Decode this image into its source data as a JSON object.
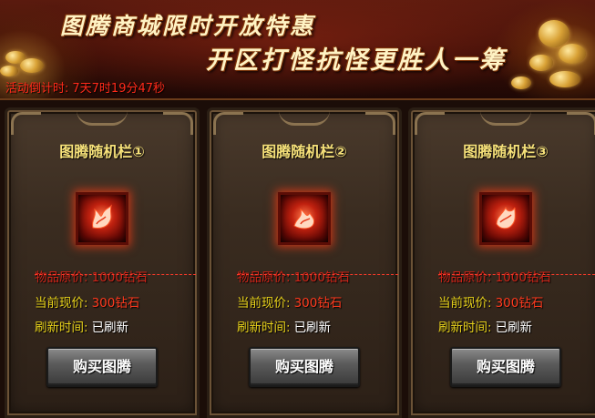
{
  "banner": {
    "title_line1": "图腾商城限时开放特惠",
    "title_line2": "开区打怪抗怪更胜人一筹"
  },
  "countdown": {
    "label": "活动倒计时:",
    "value": "7天7时19分47秒"
  },
  "cards": [
    {
      "title": "图腾随机栏①",
      "item_icon": "phoenix-totem-icon",
      "original_price_label": "物品原价:",
      "original_price": "1000钻石",
      "current_price_label": "当前现价:",
      "current_price": "300钻石",
      "refresh_label": "刷新时间:",
      "refresh_value": "已刷新",
      "buy_label": "购买图腾"
    },
    {
      "title": "图腾随机栏②",
      "item_icon": "phoenix-totem-icon",
      "original_price_label": "物品原价:",
      "original_price": "1000钻石",
      "current_price_label": "当前现价:",
      "current_price": "300钻石",
      "refresh_label": "刷新时间:",
      "refresh_value": "已刷新",
      "buy_label": "购买图腾"
    },
    {
      "title": "图腾随机栏③",
      "item_icon": "phoenix-totem-icon",
      "original_price_label": "物品原价:",
      "original_price": "1000钻石",
      "current_price_label": "当前现价:",
      "current_price": "300钻石",
      "refresh_label": "刷新时间:",
      "refresh_value": "已刷新",
      "buy_label": "购买图腾"
    }
  ],
  "colors": {
    "title_gold": "#f7e27a",
    "label_yellow": "#e8d21b",
    "price_red": "#ff3a1e",
    "countdown_red": "#ff2a1a"
  }
}
